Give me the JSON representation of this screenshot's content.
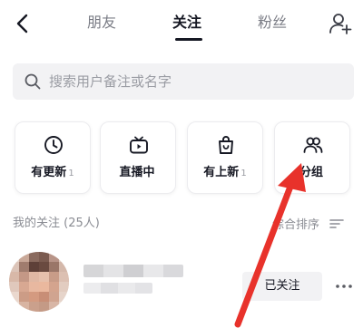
{
  "header": {
    "back_icon": "chevron-left-icon",
    "tabs": [
      {
        "label": "朋友",
        "active": false
      },
      {
        "label": "关注",
        "active": true
      },
      {
        "label": "粉丝",
        "active": false
      }
    ],
    "add_user_icon": "add-user-icon"
  },
  "search": {
    "icon": "search-icon",
    "placeholder": "搜索用户备注或名字"
  },
  "categories": [
    {
      "label": "有更新",
      "count": "1",
      "icon": "clock-icon"
    },
    {
      "label": "直播中",
      "count": "",
      "icon": "tv-icon"
    },
    {
      "label": "有上新",
      "count": "1",
      "icon": "shopping-bag-icon"
    },
    {
      "label": "分组",
      "count": "",
      "icon": "group-icon"
    }
  ],
  "section": {
    "title": "我的关注 (25人)",
    "sort_label": "综合排序",
    "sort_icon": "sort-icon"
  },
  "user": {
    "follow_label": "已关注",
    "more_icon": "more-icon"
  },
  "colors": {
    "text_primary": "#161823",
    "text_secondary": "#8a8c93",
    "search_bg": "#f2f2f4",
    "annotation_red": "#e8322b"
  }
}
